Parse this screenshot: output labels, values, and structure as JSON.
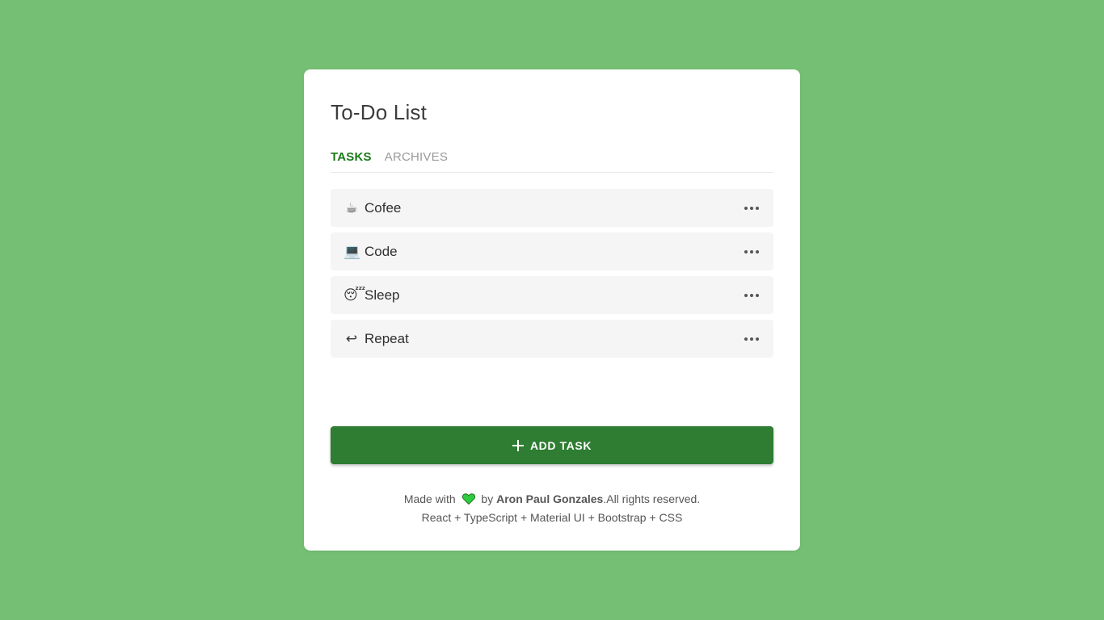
{
  "app": {
    "title": "To-Do List"
  },
  "tabs": [
    {
      "label": "TASKS",
      "active": true
    },
    {
      "label": "ARCHIVES",
      "active": false
    }
  ],
  "tasks": [
    {
      "icon": "☕",
      "icon_name": "coffee-icon",
      "label": "Cofee"
    },
    {
      "icon": "💻",
      "icon_name": "laptop-icon",
      "label": "Code"
    },
    {
      "icon": "😴",
      "icon_name": "sleeping-face-icon",
      "label": "Sleep"
    },
    {
      "icon": "↩",
      "icon_name": "return-arrow-icon",
      "label": "Repeat"
    }
  ],
  "add_button": {
    "label": "ADD TASK"
  },
  "footer": {
    "made_with": "Made with",
    "by": "by",
    "author": "Aron Paul Gonzales",
    "rights": ".All rights reserved.",
    "stack": "React + TypeScript + Material UI + Bootstrap + CSS"
  },
  "colors": {
    "background": "#74bf73",
    "accent": "#2e7d32",
    "active_tab": "#1b7a1b",
    "heart": "#2ecc40"
  }
}
